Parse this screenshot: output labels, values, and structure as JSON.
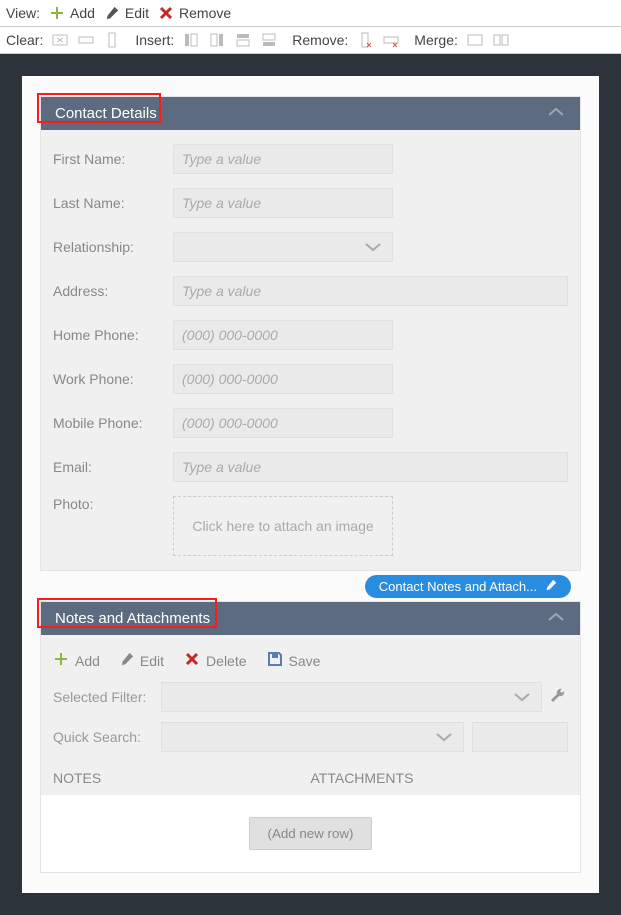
{
  "toolbar1": {
    "view_label": "View:",
    "add": "Add",
    "edit": "Edit",
    "remove": "Remove"
  },
  "toolbar2": {
    "clear_label": "Clear:",
    "insert_label": "Insert:",
    "remove_label": "Remove:",
    "merge_label": "Merge:"
  },
  "contact_panel": {
    "title": "Contact Details",
    "fields": {
      "first_name": {
        "label": "First Name:",
        "placeholder": "Type a value"
      },
      "last_name": {
        "label": "Last Name:",
        "placeholder": "Type a value"
      },
      "relationship": {
        "label": "Relationship:"
      },
      "address": {
        "label": "Address:",
        "placeholder": "Type a value"
      },
      "home_phone": {
        "label": "Home Phone:",
        "placeholder": "(000) 000-0000"
      },
      "work_phone": {
        "label": "Work Phone:",
        "placeholder": "(000) 000-0000"
      },
      "mobile_phone": {
        "label": "Mobile Phone:",
        "placeholder": "(000) 000-0000"
      },
      "email": {
        "label": "Email:",
        "placeholder": "Type a value"
      },
      "photo": {
        "label": "Photo:",
        "placeholder": "Click here to attach an image"
      }
    }
  },
  "notes_panel": {
    "title": "Notes and Attachments",
    "bubble_text": "Contact Notes and Attach...",
    "toolbar": {
      "add": "Add",
      "edit": "Edit",
      "delete": "Delete",
      "save": "Save"
    },
    "filters": {
      "selected_filter": "Selected Filter:",
      "quick_search": "Quick Search:"
    },
    "columns": {
      "notes": "NOTES",
      "attachments": "ATTACHMENTS"
    },
    "add_row": "(Add new row)"
  }
}
